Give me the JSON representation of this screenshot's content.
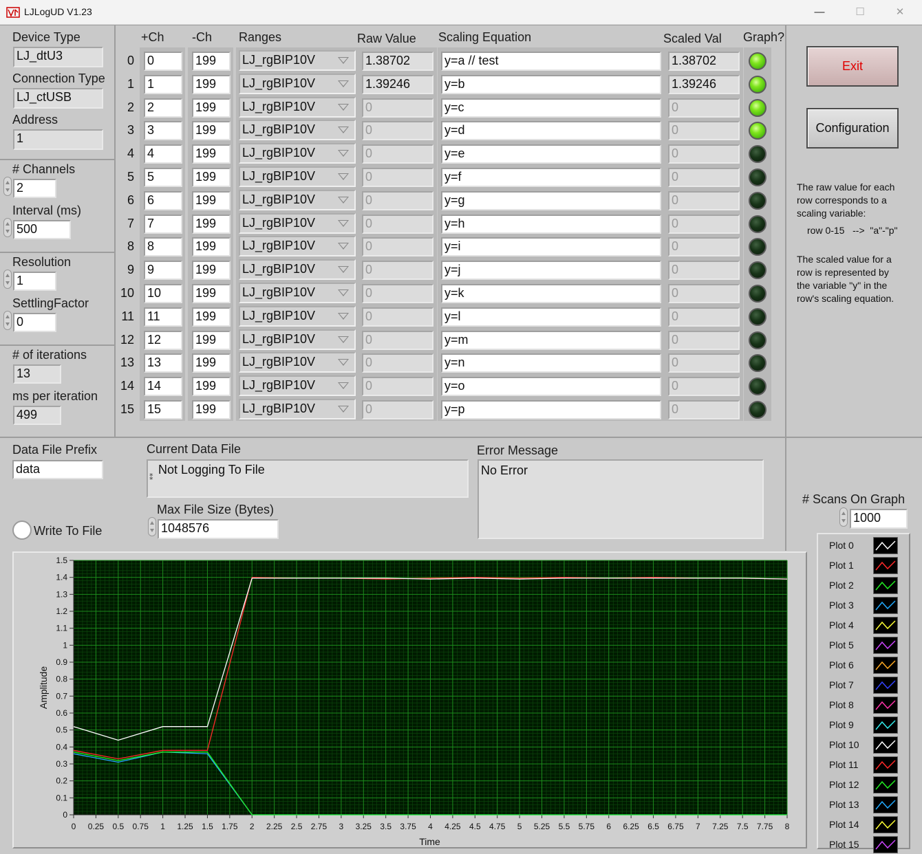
{
  "window": {
    "title": "LJLogUD V1.23",
    "controls": [
      "—",
      "☐",
      "✕"
    ]
  },
  "device": {
    "device_type_label": "Device Type",
    "device_type": "LJ_dtU3",
    "connection_type_label": "Connection Type",
    "connection_type": "LJ_ctUSB",
    "address_label": "Address",
    "address": "1"
  },
  "settings": {
    "channels_label": "# Channels",
    "channels": "2",
    "interval_label": "Interval (ms)",
    "interval": "500",
    "resolution_label": "Resolution",
    "resolution": "1",
    "settling_label": "SettlingFactor",
    "settling": "0",
    "iterations_label": "# of iterations",
    "iterations": "13",
    "ms_per_iter_label": "ms per iteration",
    "ms_per_iter": "499"
  },
  "table": {
    "headers": {
      "pos": "+Ch",
      "neg": "-Ch",
      "ranges": "Ranges",
      "raw": "Raw Value",
      "eq": "Scaling Equation",
      "scaled": "Scaled Val",
      "graph": "Graph?"
    },
    "rows": [
      {
        "n": "0",
        "pos": "0",
        "neg": "199",
        "range": "LJ_rgBIP10V",
        "raw": "1.38702",
        "eq": "y=a // test",
        "scaled": "1.38702",
        "led": "on"
      },
      {
        "n": "1",
        "pos": "1",
        "neg": "199",
        "range": "LJ_rgBIP10V",
        "raw": "1.39246",
        "eq": "y=b",
        "scaled": "1.39246",
        "led": "on"
      },
      {
        "n": "2",
        "pos": "2",
        "neg": "199",
        "range": "LJ_rgBIP10V",
        "raw": "0",
        "eq": "y=c",
        "scaled": "0",
        "led": "on"
      },
      {
        "n": "3",
        "pos": "3",
        "neg": "199",
        "range": "LJ_rgBIP10V",
        "raw": "0",
        "eq": "y=d",
        "scaled": "0",
        "led": "on"
      },
      {
        "n": "4",
        "pos": "4",
        "neg": "199",
        "range": "LJ_rgBIP10V",
        "raw": "0",
        "eq": "y=e",
        "scaled": "0",
        "led": "off"
      },
      {
        "n": "5",
        "pos": "5",
        "neg": "199",
        "range": "LJ_rgBIP10V",
        "raw": "0",
        "eq": "y=f",
        "scaled": "0",
        "led": "off"
      },
      {
        "n": "6",
        "pos": "6",
        "neg": "199",
        "range": "LJ_rgBIP10V",
        "raw": "0",
        "eq": "y=g",
        "scaled": "0",
        "led": "off"
      },
      {
        "n": "7",
        "pos": "7",
        "neg": "199",
        "range": "LJ_rgBIP10V",
        "raw": "0",
        "eq": "y=h",
        "scaled": "0",
        "led": "off"
      },
      {
        "n": "8",
        "pos": "8",
        "neg": "199",
        "range": "LJ_rgBIP10V",
        "raw": "0",
        "eq": "y=i",
        "scaled": "0",
        "led": "off"
      },
      {
        "n": "9",
        "pos": "9",
        "neg": "199",
        "range": "LJ_rgBIP10V",
        "raw": "0",
        "eq": "y=j",
        "scaled": "0",
        "led": "off"
      },
      {
        "n": "10",
        "pos": "10",
        "neg": "199",
        "range": "LJ_rgBIP10V",
        "raw": "0",
        "eq": "y=k",
        "scaled": "0",
        "led": "off"
      },
      {
        "n": "11",
        "pos": "11",
        "neg": "199",
        "range": "LJ_rgBIP10V",
        "raw": "0",
        "eq": "y=l",
        "scaled": "0",
        "led": "off"
      },
      {
        "n": "12",
        "pos": "12",
        "neg": "199",
        "range": "LJ_rgBIP10V",
        "raw": "0",
        "eq": "y=m",
        "scaled": "0",
        "led": "off"
      },
      {
        "n": "13",
        "pos": "13",
        "neg": "199",
        "range": "LJ_rgBIP10V",
        "raw": "0",
        "eq": "y=n",
        "scaled": "0",
        "led": "off"
      },
      {
        "n": "14",
        "pos": "14",
        "neg": "199",
        "range": "LJ_rgBIP10V",
        "raw": "0",
        "eq": "y=o",
        "scaled": "0",
        "led": "off"
      },
      {
        "n": "15",
        "pos": "15",
        "neg": "199",
        "range": "LJ_rgBIP10V",
        "raw": "0",
        "eq": "y=p",
        "scaled": "0",
        "led": "off"
      }
    ]
  },
  "buttons": {
    "exit": "Exit",
    "config": "Configuration"
  },
  "info": {
    "p1": [
      "The raw value for each",
      "row corresponds to a",
      "scaling variable:"
    ],
    "p2": "row 0-15   -->  \"a\"-\"p\"",
    "p3": [
      "The scaled value for a",
      "row is represented by",
      "the variable  \"y\" in the",
      "row's scaling equation."
    ]
  },
  "file": {
    "prefix_label": "Data File Prefix",
    "prefix": "data",
    "current_label": "Current Data File",
    "current": "Not Logging To File",
    "maxsize_label": "Max File Size (Bytes)",
    "maxsize": "1048576",
    "write_label": "Write To File"
  },
  "error": {
    "label": "Error Message",
    "message": "No Error"
  },
  "scans": {
    "label": "# Scans On Graph",
    "value": "1000"
  },
  "colors": {
    "grid_bg": "#001a00",
    "grid_major": "#1c8a1c",
    "grid_minor": "#0d4a0d"
  },
  "chart_data": {
    "type": "line",
    "xlabel": "Time",
    "ylabel": "Amplitude",
    "xlim": [
      0,
      8
    ],
    "ylim": [
      0,
      1.5
    ],
    "x_ticks": [
      "0",
      "0.25",
      "0.5",
      "0.75",
      "1",
      "1.25",
      "1.5",
      "1.75",
      "2",
      "2.25",
      "2.5",
      "2.75",
      "3",
      "3.25",
      "3.5",
      "3.75",
      "4",
      "4.25",
      "4.5",
      "4.75",
      "5",
      "5.25",
      "5.5",
      "5.75",
      "6",
      "6.25",
      "6.5",
      "6.75",
      "7",
      "7.25",
      "7.5",
      "7.75",
      "8"
    ],
    "y_ticks": [
      "0",
      "0.1",
      "0.2",
      "0.3",
      "0.4",
      "0.5",
      "0.6",
      "0.7",
      "0.8",
      "0.9",
      "1",
      "1.1",
      "1.2",
      "1.3",
      "1.4",
      "1.5"
    ],
    "series": [
      {
        "name": "Plot 0",
        "color": "#ffffff",
        "x": [
          0,
          0.5,
          1,
          1.5,
          2,
          2.5,
          3,
          3.5,
          4,
          4.5,
          5,
          5.5,
          6,
          6.5,
          7,
          7.5,
          8
        ],
        "y": [
          0.52,
          0.44,
          0.52,
          0.52,
          1.395,
          1.395,
          1.395,
          1.395,
          1.39,
          1.395,
          1.39,
          1.395,
          1.395,
          1.395,
          1.395,
          1.395,
          1.39
        ]
      },
      {
        "name": "Plot 1",
        "color": "#ff2a2a",
        "x": [
          0,
          0.5,
          1,
          1.5,
          2,
          2.5,
          3,
          3.5,
          4,
          4.5,
          5,
          5.5,
          6,
          6.5,
          7,
          7.5,
          8
        ],
        "y": [
          0.38,
          0.33,
          0.38,
          0.38,
          1.4,
          1.395,
          1.395,
          1.39,
          1.395,
          1.4,
          1.395,
          1.4,
          1.395,
          1.4,
          1.395,
          1.395,
          1.39
        ]
      },
      {
        "name": "Plot 2",
        "color": "#22ee22",
        "x": [
          0,
          0.5,
          1,
          1.5,
          2,
          2.5,
          3,
          3.5,
          4,
          4.5,
          5,
          5.5,
          6,
          6.5,
          7,
          7.5,
          8
        ],
        "y": [
          0.37,
          0.32,
          0.37,
          0.37,
          0,
          0,
          0,
          0,
          0,
          0,
          0,
          0,
          0,
          0,
          0,
          0,
          0
        ]
      },
      {
        "name": "Plot 3",
        "color": "#22aaff",
        "x": [
          0,
          0.5,
          1,
          1.5,
          2,
          2.5,
          3,
          3.5,
          4,
          4.5,
          5,
          5.5,
          6,
          6.5,
          7,
          7.5,
          8
        ],
        "y": [
          0.36,
          0.31,
          0.37,
          0.36,
          0,
          0,
          0,
          0,
          0,
          0,
          0,
          0,
          0,
          0,
          0,
          0,
          0
        ]
      }
    ],
    "legend": [
      {
        "name": "Plot 0",
        "color": "#ffffff"
      },
      {
        "name": "Plot 1",
        "color": "#ff2a2a"
      },
      {
        "name": "Plot 2",
        "color": "#22ee22"
      },
      {
        "name": "Plot 3",
        "color": "#22aaff"
      },
      {
        "name": "Plot 4",
        "color": "#ffff33"
      },
      {
        "name": "Plot 5",
        "color": "#cc44ff"
      },
      {
        "name": "Plot 6",
        "color": "#ffaa22"
      },
      {
        "name": "Plot 7",
        "color": "#3344ff"
      },
      {
        "name": "Plot 8",
        "color": "#ff33aa"
      },
      {
        "name": "Plot 9",
        "color": "#33eeee"
      },
      {
        "name": "Plot 10",
        "color": "#ffffff"
      },
      {
        "name": "Plot 11",
        "color": "#ff2a2a"
      },
      {
        "name": "Plot 12",
        "color": "#22ee22"
      },
      {
        "name": "Plot 13",
        "color": "#22aaff"
      },
      {
        "name": "Plot 14",
        "color": "#ffff33"
      },
      {
        "name": "Plot 15",
        "color": "#cc44ff"
      }
    ]
  }
}
